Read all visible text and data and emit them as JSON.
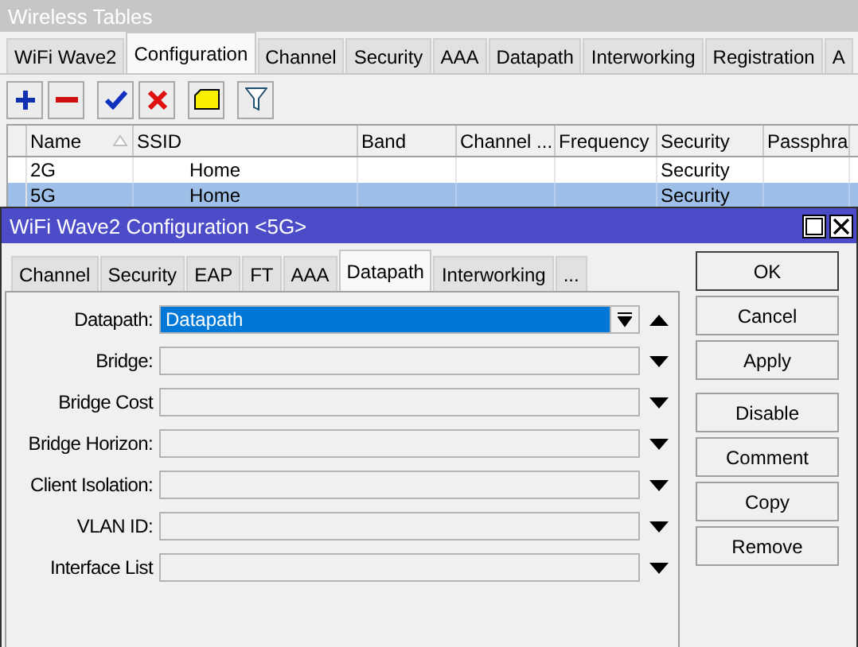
{
  "main_window": {
    "title": "Wireless Tables",
    "tabs": [
      {
        "label": "WiFi Wave2",
        "selected": false
      },
      {
        "label": "Configuration",
        "selected": true
      },
      {
        "label": "Channel",
        "selected": false
      },
      {
        "label": "Security",
        "selected": false
      },
      {
        "label": "AAA",
        "selected": false
      },
      {
        "label": "Datapath",
        "selected": false
      },
      {
        "label": "Interworking",
        "selected": false
      },
      {
        "label": "Registration",
        "selected": false
      },
      {
        "label": "A",
        "selected": false
      }
    ],
    "table": {
      "columns": [
        {
          "label": "Name",
          "sorted": true
        },
        {
          "label": "SSID"
        },
        {
          "label": "Band"
        },
        {
          "label": "Channel ..."
        },
        {
          "label": "Frequency"
        },
        {
          "label": "Security"
        },
        {
          "label": "Passphra"
        }
      ],
      "rows": [
        {
          "cells": [
            "2G",
            "Home",
            "",
            "",
            "",
            "Security",
            ""
          ],
          "selected": false
        },
        {
          "cells": [
            "5G",
            "Home",
            "",
            "",
            "",
            "Security",
            ""
          ],
          "selected": true
        }
      ]
    }
  },
  "dialog": {
    "title": "WiFi Wave2 Configuration <5G>",
    "tabs": [
      {
        "label": "Channel",
        "selected": false
      },
      {
        "label": "Security",
        "selected": false
      },
      {
        "label": "EAP",
        "selected": false
      },
      {
        "label": "FT",
        "selected": false
      },
      {
        "label": "AAA",
        "selected": false
      },
      {
        "label": "Datapath",
        "selected": true
      },
      {
        "label": "Interworking",
        "selected": false
      },
      {
        "label": "...",
        "selected": false
      }
    ],
    "fields": [
      {
        "label": "Datapath:",
        "value": "Datapath",
        "selected": true,
        "expanded": true
      },
      {
        "label": "Bridge:",
        "selected": false,
        "expanded": false
      },
      {
        "label": "Bridge Cost",
        "selected": false,
        "expanded": false
      },
      {
        "label": "Bridge Horizon:",
        "selected": false,
        "expanded": false
      },
      {
        "label": "Client Isolation:",
        "selected": false,
        "expanded": false
      },
      {
        "label": "VLAN ID:",
        "selected": false,
        "expanded": false
      },
      {
        "label": "Interface List",
        "selected": false,
        "expanded": false
      }
    ],
    "button_groups": [
      [
        {
          "label": "OK",
          "default": true
        },
        {
          "label": "Cancel",
          "default": false
        },
        {
          "label": "Apply",
          "default": false
        }
      ],
      [
        {
          "label": "Disable",
          "default": false
        },
        {
          "label": "Comment",
          "default": false
        },
        {
          "label": "Copy",
          "default": false
        },
        {
          "label": "Remove",
          "default": false
        }
      ]
    ]
  }
}
